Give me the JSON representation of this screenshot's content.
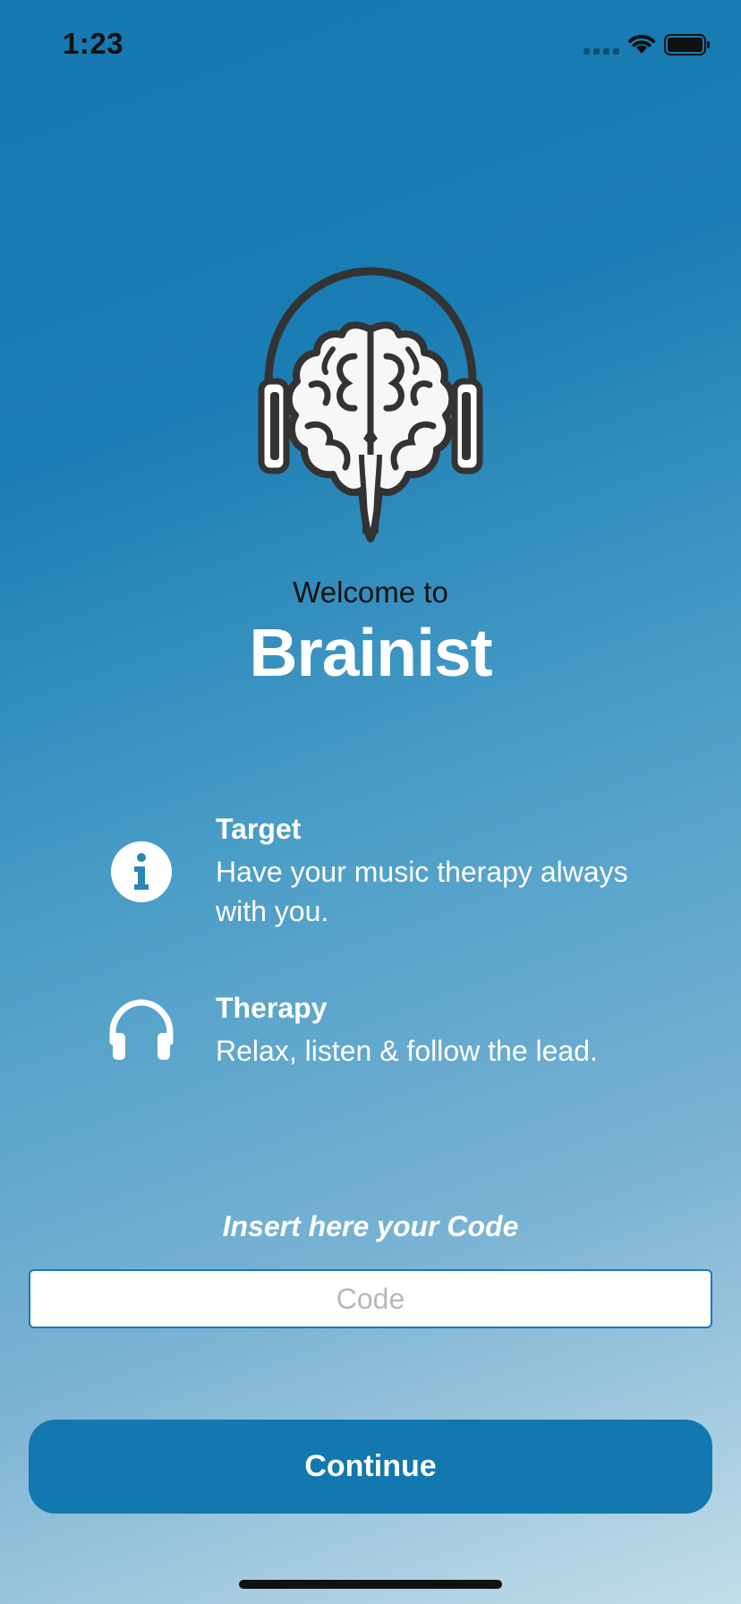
{
  "status_bar": {
    "time": "1:23"
  },
  "welcome": {
    "subtitle": "Welcome to",
    "app_name": "Brainist"
  },
  "features": [
    {
      "icon": "info-circle-icon",
      "title": "Target",
      "description": "Have your music therapy always with you."
    },
    {
      "icon": "headphones-icon",
      "title": "Therapy",
      "description": "Relax, listen & follow the lead."
    }
  ],
  "code": {
    "label": "Insert here your Code",
    "placeholder": "Code",
    "value": ""
  },
  "continue_label": "Continue",
  "colors": {
    "accent": "#1278af",
    "input_border": "#1a78c2",
    "gradient_top": "#1579b0",
    "gradient_bottom": "#c3dde9"
  }
}
